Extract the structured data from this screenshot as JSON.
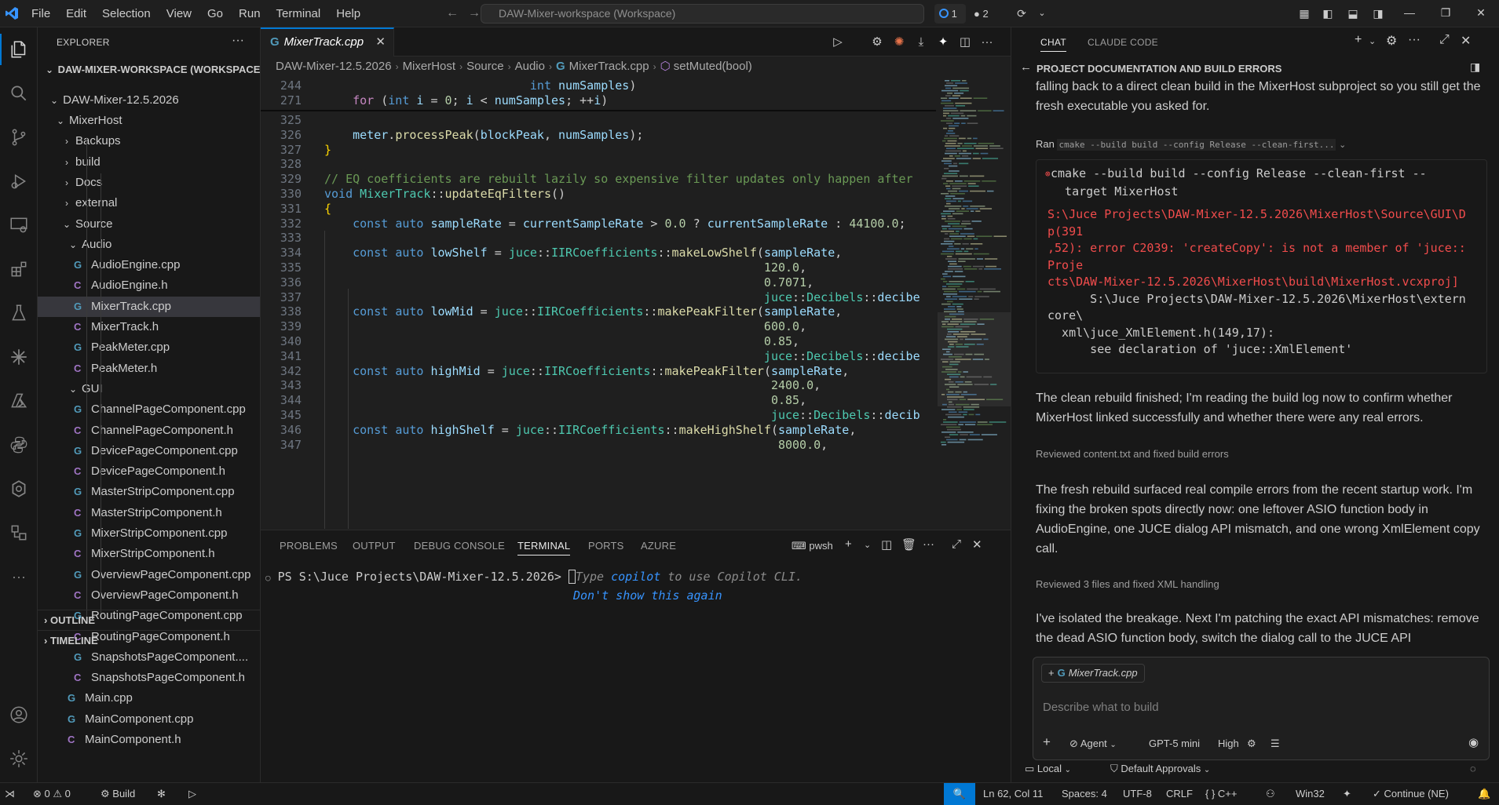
{
  "titlebar": {
    "menus": [
      "File",
      "Edit",
      "Selection",
      "View",
      "Go",
      "Run",
      "Terminal",
      "Help"
    ],
    "command_center": "DAW-Mixer-workspace (Workspace)",
    "badge_1": "1",
    "badge_2": "2"
  },
  "explorer": {
    "title": "EXPLORER",
    "workspace": "DAW-MIXER-WORKSPACE (WORKSPACE)",
    "root": "DAW-Mixer-12.5.2026",
    "tree": [
      {
        "label": "MixerHost",
        "depth": 1,
        "kind": "folder-open"
      },
      {
        "label": "Backups",
        "depth": 2,
        "kind": "folder"
      },
      {
        "label": "build",
        "depth": 2,
        "kind": "folder"
      },
      {
        "label": "Docs",
        "depth": 2,
        "kind": "folder"
      },
      {
        "label": "external",
        "depth": 2,
        "kind": "folder"
      },
      {
        "label": "Source",
        "depth": 2,
        "kind": "folder-open"
      },
      {
        "label": "Audio",
        "depth": 3,
        "kind": "folder-open"
      },
      {
        "label": "AudioEngine.cpp",
        "depth": 4,
        "kind": "cpp"
      },
      {
        "label": "AudioEngine.h",
        "depth": 4,
        "kind": "h"
      },
      {
        "label": "MixerTrack.cpp",
        "depth": 4,
        "kind": "cpp",
        "selected": true
      },
      {
        "label": "MixerTrack.h",
        "depth": 4,
        "kind": "h"
      },
      {
        "label": "PeakMeter.cpp",
        "depth": 4,
        "kind": "cpp"
      },
      {
        "label": "PeakMeter.h",
        "depth": 4,
        "kind": "h"
      },
      {
        "label": "GUI",
        "depth": 3,
        "kind": "folder-open"
      },
      {
        "label": "ChannelPageComponent.cpp",
        "depth": 4,
        "kind": "cpp"
      },
      {
        "label": "ChannelPageComponent.h",
        "depth": 4,
        "kind": "h"
      },
      {
        "label": "DevicePageComponent.cpp",
        "depth": 4,
        "kind": "cpp"
      },
      {
        "label": "DevicePageComponent.h",
        "depth": 4,
        "kind": "h"
      },
      {
        "label": "MasterStripComponent.cpp",
        "depth": 4,
        "kind": "cpp"
      },
      {
        "label": "MasterStripComponent.h",
        "depth": 4,
        "kind": "h"
      },
      {
        "label": "MixerStripComponent.cpp",
        "depth": 4,
        "kind": "cpp"
      },
      {
        "label": "MixerStripComponent.h",
        "depth": 4,
        "kind": "h"
      },
      {
        "label": "OverviewPageComponent.cpp",
        "depth": 4,
        "kind": "cpp"
      },
      {
        "label": "OverviewPageComponent.h",
        "depth": 4,
        "kind": "h"
      },
      {
        "label": "RoutingPageComponent.cpp",
        "depth": 4,
        "kind": "cpp"
      },
      {
        "label": "RoutingPageComponent.h",
        "depth": 4,
        "kind": "h"
      },
      {
        "label": "SnapshotsPageComponent....",
        "depth": 4,
        "kind": "cpp"
      },
      {
        "label": "SnapshotsPageComponent.h",
        "depth": 4,
        "kind": "h"
      },
      {
        "label": "Main.cpp",
        "depth": 3,
        "kind": "cpp"
      },
      {
        "label": "MainComponent.cpp",
        "depth": 3,
        "kind": "cpp"
      },
      {
        "label": "MainComponent.h",
        "depth": 3,
        "kind": "h"
      }
    ],
    "outline": "OUTLINE",
    "timeline": "TIMELINE"
  },
  "editor": {
    "tab": "MixerTrack.cpp",
    "breadcrumb": [
      "DAW-Mixer-12.5.2026",
      "MixerHost",
      "Source",
      "Audio",
      "MixerTrack.cpp",
      "setMuted(bool)"
    ],
    "lines": [
      {
        "n": "244",
        "text": "                             int numSamples)"
      },
      {
        "n": "271",
        "text": "    for (int i = 0; i < numSamples; ++i)"
      },
      {
        "n": "325",
        "text": ""
      },
      {
        "n": "326",
        "text": "    meter.processPeak(blockPeak, numSamples);"
      },
      {
        "n": "327",
        "text": "}"
      },
      {
        "n": "328",
        "text": ""
      },
      {
        "n": "329",
        "text": "// EQ coefficients are rebuilt lazily so expensive filter updates only happen after"
      },
      {
        "n": "330",
        "text": "void MixerTrack::updateEqFilters()"
      },
      {
        "n": "331",
        "text": "{"
      },
      {
        "n": "332",
        "text": "    const auto sampleRate = currentSampleRate > 0.0 ? currentSampleRate : 44100.0;"
      },
      {
        "n": "333",
        "text": ""
      },
      {
        "n": "334",
        "text": "    const auto lowShelf = juce::IIRCoefficients::makeLowShelf(sampleRate,"
      },
      {
        "n": "335",
        "text": "                                                              120.0,"
      },
      {
        "n": "336",
        "text": "                                                              0.7071,"
      },
      {
        "n": "337",
        "text": "                                                              juce::Decibels::decibe"
      },
      {
        "n": "338",
        "text": "    const auto lowMid = juce::IIRCoefficients::makePeakFilter(sampleRate,"
      },
      {
        "n": "339",
        "text": "                                                              600.0,"
      },
      {
        "n": "340",
        "text": "                                                              0.85,"
      },
      {
        "n": "341",
        "text": "                                                              juce::Decibels::decibe"
      },
      {
        "n": "342",
        "text": "    const auto highMid = juce::IIRCoefficients::makePeakFilter(sampleRate,"
      },
      {
        "n": "343",
        "text": "                                                               2400.0,"
      },
      {
        "n": "344",
        "text": "                                                               0.85,"
      },
      {
        "n": "345",
        "text": "                                                               juce::Decibels::decib"
      },
      {
        "n": "346",
        "text": "    const auto highShelf = juce::IIRCoefficients::makeHighShelf(sampleRate,"
      },
      {
        "n": "347",
        "text": "                                                                8000.0,"
      }
    ]
  },
  "panel": {
    "tabs": [
      "PROBLEMS",
      "OUTPUT",
      "DEBUG CONSOLE",
      "TERMINAL",
      "PORTS",
      "AZURE"
    ],
    "active_tab": "TERMINAL",
    "shell": "pwsh",
    "prompt": "PS S:\\Juce Projects\\DAW-Mixer-12.5.2026>",
    "hint_pre": "Type ",
    "hint_word": "copilot",
    "hint_post": " to use Copilot CLI.",
    "hint_dismiss": "Don't show this again"
  },
  "chat": {
    "tabs": [
      "CHAT",
      "CLAUDE CODE"
    ],
    "title": "PROJECT DOCUMENTATION AND BUILD ERRORS",
    "p0": "falling back to a direct clean build in the MixerHost subproject so you still get the fresh executable you asked for.",
    "ran_label": "Ran",
    "ran_cmd": "cmake --build build --config Release --clean-first...",
    "term_cmd": "cmake --build build --config Release --clean-first --\n  target MixerHost",
    "term_err": "S:\\Juce Projects\\DAW-Mixer-12.5.2026\\MixerHost\\Source\\GUI\\D\np(391\n,52): error C2039: 'createCopy': is not a member of 'juce::\nProje\ncts\\DAW-Mixer-12.5.2026\\MixerHost\\build\\MixerHost.vcxproj]",
    "term_norm": "      S:\\Juce Projects\\DAW-Mixer-12.5.2026\\MixerHost\\extern\ncore\\\n  xml\\juce_XmlElement.h(149,17):\n      see declaration of 'juce::XmlElement'",
    "p1": "The clean rebuild finished; I'm reading the build log now to confirm whether MixerHost linked successfully and whether there were any real errors.",
    "meta1_label": "Reviewed",
    "meta1_text": "content.txt and fixed build errors",
    "p2": "The fresh rebuild surfaced real compile errors from the recent startup work. I'm fixing the broken spots directly now: one leftover ASIO function body in AudioEngine, one JUCE dialog API mismatch, and one wrong XmlElement copy call.",
    "meta2_label": "Reviewed",
    "meta2_text": "3 files and fixed XML handling",
    "p3": "I've isolated the breakage. Next I'm patching the exact API mismatches: remove the dead ASIO function body, switch the dialog call to the JUCE API",
    "attachment": "MixerTrack.cpp",
    "placeholder": "Describe what to build",
    "mode": "Agent",
    "model": "GPT-5 mini",
    "effort": "High",
    "location": "Local",
    "approvals": "Default Approvals"
  },
  "statusbar": {
    "errors": "0",
    "warnings": "0",
    "build": "Build",
    "position": "Ln 62, Col 11",
    "spaces": "Spaces: 4",
    "encoding": "UTF-8",
    "eol": "CRLF",
    "language": "C++",
    "platform": "Win32",
    "continue": "Continue (NE)"
  },
  "colors": {
    "accent": "#0078d4",
    "error": "#f14c4c",
    "background": "#1f1f1f",
    "sidebar": "#181818"
  }
}
